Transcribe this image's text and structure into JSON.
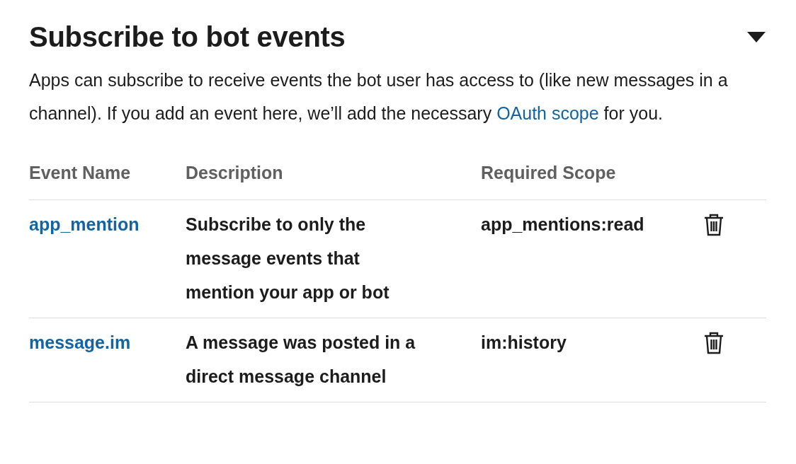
{
  "section": {
    "title": "Subscribe to bot events",
    "expanded": true,
    "description_before": "Apps can subscribe to receive events the bot user has access to (like new messages in a channel). If you add an event here, we’ll add the necessary ",
    "description_link": "OAuth scope",
    "description_after": " for you."
  },
  "table": {
    "columns": [
      "Event Name",
      "Description",
      "Required Scope"
    ],
    "rows": [
      {
        "event": "app_mention",
        "description": "Subscribe to only the message events that mention your app or bot",
        "scope": "app_mentions:read"
      },
      {
        "event": "message.im",
        "description": "A message was posted in a direct message channel",
        "scope": "im:history"
      }
    ]
  }
}
